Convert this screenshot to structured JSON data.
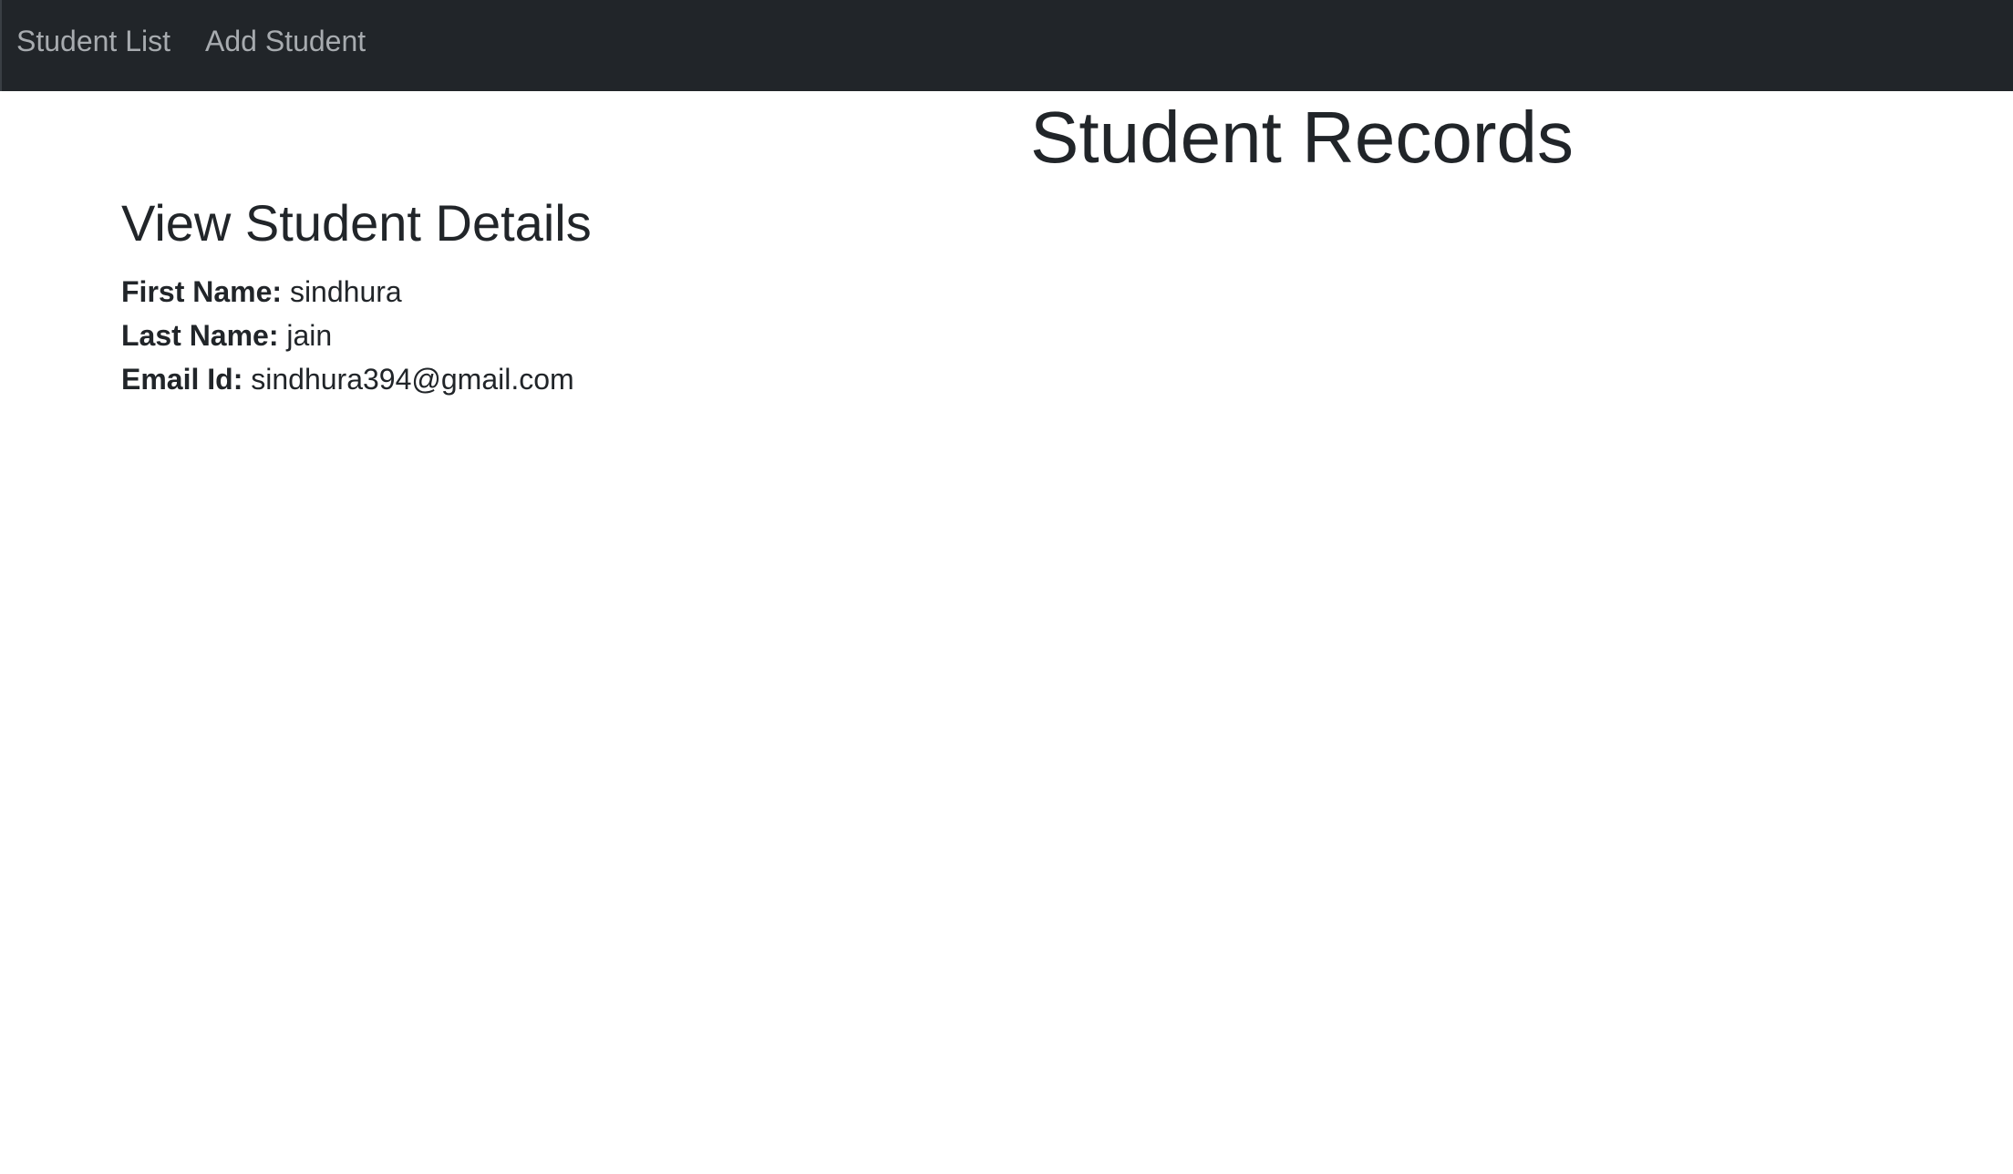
{
  "navbar": {
    "links": [
      {
        "label": "Student List"
      },
      {
        "label": "Add Student"
      }
    ],
    "background": "#212529",
    "link_color": "#a7abaf"
  },
  "page": {
    "title": "Student Records"
  },
  "details": {
    "heading": "View Student Details",
    "first_name_label": "First Name:",
    "first_name": "sindhura",
    "last_name_label": "Last Name:",
    "last_name": "jain",
    "email_label": "Email Id:",
    "email": "sindhura394@gmail.com"
  }
}
